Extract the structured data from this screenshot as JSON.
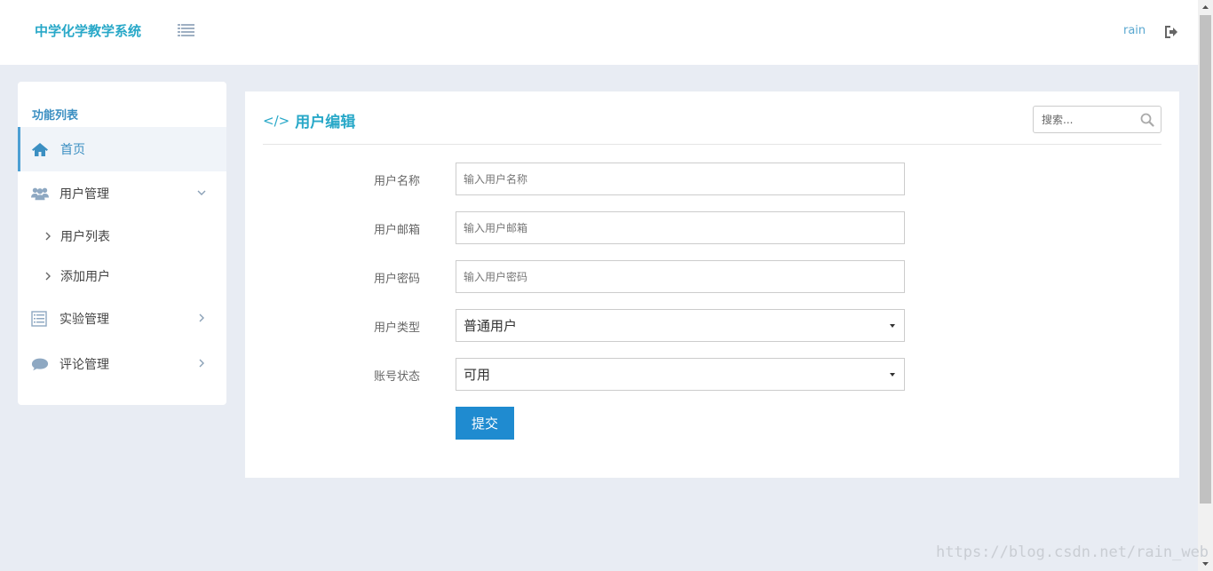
{
  "header": {
    "brand": "中学化学教学系统",
    "username": "rain",
    "menu_icon": "list-icon",
    "logout_icon": "sign-out-icon"
  },
  "sidebar": {
    "title": "功能列表",
    "items": [
      {
        "label": "首页",
        "icon": "home-icon",
        "active": true
      },
      {
        "label": "用户管理",
        "icon": "users-icon",
        "expanded": true
      },
      {
        "label": "实验管理",
        "icon": "list-alt-icon"
      },
      {
        "label": "评论管理",
        "icon": "comment-icon"
      }
    ],
    "subitems": [
      {
        "label": "用户列表"
      },
      {
        "label": "添加用户"
      }
    ]
  },
  "panel": {
    "title": "用户编辑",
    "title_icon": "code-icon",
    "search_placeholder": "搜索..."
  },
  "form": {
    "username_label": "用户名称",
    "username_placeholder": "输入用户名称",
    "email_label": "用户邮箱",
    "email_placeholder": "输入用户邮箱",
    "password_label": "用户密码",
    "password_placeholder": "输入用户密码",
    "type_label": "用户类型",
    "type_value": "普通用户",
    "status_label": "账号状态",
    "status_value": "可用",
    "submit_label": "提交"
  },
  "watermark": "https://blog.csdn.net/rain_web",
  "colors": {
    "accent": "#28a8c8",
    "primary_button": "#1f8bd0",
    "background": "#e8ecf3",
    "sidebar_active_border": "#4c9fd3"
  }
}
